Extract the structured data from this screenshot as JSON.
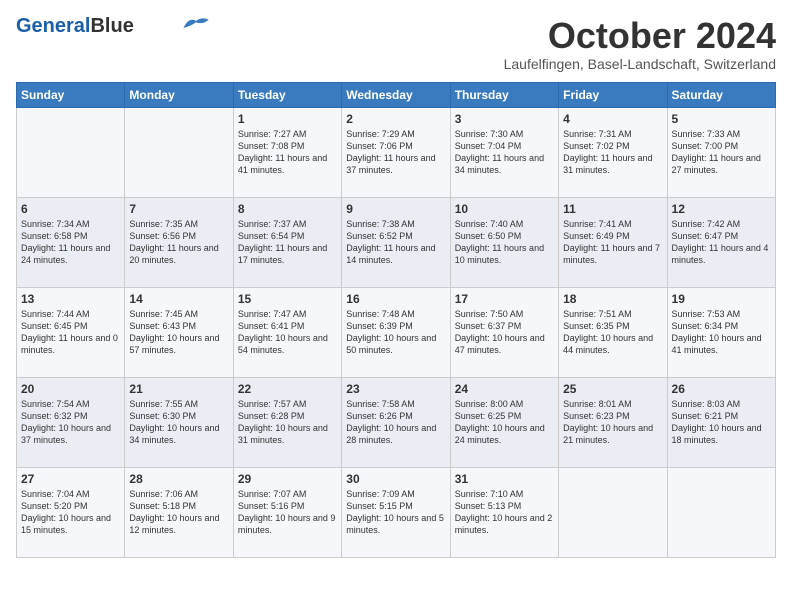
{
  "header": {
    "logo_line1": "General",
    "logo_line2": "Blue",
    "month_year": "October 2024",
    "location": "Laufelfingen, Basel-Landschaft, Switzerland"
  },
  "days_of_week": [
    "Sunday",
    "Monday",
    "Tuesday",
    "Wednesday",
    "Thursday",
    "Friday",
    "Saturday"
  ],
  "weeks": [
    [
      {
        "day": "",
        "info": ""
      },
      {
        "day": "",
        "info": ""
      },
      {
        "day": "1",
        "info": "Sunrise: 7:27 AM\nSunset: 7:08 PM\nDaylight: 11 hours and 41 minutes."
      },
      {
        "day": "2",
        "info": "Sunrise: 7:29 AM\nSunset: 7:06 PM\nDaylight: 11 hours and 37 minutes."
      },
      {
        "day": "3",
        "info": "Sunrise: 7:30 AM\nSunset: 7:04 PM\nDaylight: 11 hours and 34 minutes."
      },
      {
        "day": "4",
        "info": "Sunrise: 7:31 AM\nSunset: 7:02 PM\nDaylight: 11 hours and 31 minutes."
      },
      {
        "day": "5",
        "info": "Sunrise: 7:33 AM\nSunset: 7:00 PM\nDaylight: 11 hours and 27 minutes."
      }
    ],
    [
      {
        "day": "6",
        "info": "Sunrise: 7:34 AM\nSunset: 6:58 PM\nDaylight: 11 hours and 24 minutes."
      },
      {
        "day": "7",
        "info": "Sunrise: 7:35 AM\nSunset: 6:56 PM\nDaylight: 11 hours and 20 minutes."
      },
      {
        "day": "8",
        "info": "Sunrise: 7:37 AM\nSunset: 6:54 PM\nDaylight: 11 hours and 17 minutes."
      },
      {
        "day": "9",
        "info": "Sunrise: 7:38 AM\nSunset: 6:52 PM\nDaylight: 11 hours and 14 minutes."
      },
      {
        "day": "10",
        "info": "Sunrise: 7:40 AM\nSunset: 6:50 PM\nDaylight: 11 hours and 10 minutes."
      },
      {
        "day": "11",
        "info": "Sunrise: 7:41 AM\nSunset: 6:49 PM\nDaylight: 11 hours and 7 minutes."
      },
      {
        "day": "12",
        "info": "Sunrise: 7:42 AM\nSunset: 6:47 PM\nDaylight: 11 hours and 4 minutes."
      }
    ],
    [
      {
        "day": "13",
        "info": "Sunrise: 7:44 AM\nSunset: 6:45 PM\nDaylight: 11 hours and 0 minutes."
      },
      {
        "day": "14",
        "info": "Sunrise: 7:45 AM\nSunset: 6:43 PM\nDaylight: 10 hours and 57 minutes."
      },
      {
        "day": "15",
        "info": "Sunrise: 7:47 AM\nSunset: 6:41 PM\nDaylight: 10 hours and 54 minutes."
      },
      {
        "day": "16",
        "info": "Sunrise: 7:48 AM\nSunset: 6:39 PM\nDaylight: 10 hours and 50 minutes."
      },
      {
        "day": "17",
        "info": "Sunrise: 7:50 AM\nSunset: 6:37 PM\nDaylight: 10 hours and 47 minutes."
      },
      {
        "day": "18",
        "info": "Sunrise: 7:51 AM\nSunset: 6:35 PM\nDaylight: 10 hours and 44 minutes."
      },
      {
        "day": "19",
        "info": "Sunrise: 7:53 AM\nSunset: 6:34 PM\nDaylight: 10 hours and 41 minutes."
      }
    ],
    [
      {
        "day": "20",
        "info": "Sunrise: 7:54 AM\nSunset: 6:32 PM\nDaylight: 10 hours and 37 minutes."
      },
      {
        "day": "21",
        "info": "Sunrise: 7:55 AM\nSunset: 6:30 PM\nDaylight: 10 hours and 34 minutes."
      },
      {
        "day": "22",
        "info": "Sunrise: 7:57 AM\nSunset: 6:28 PM\nDaylight: 10 hours and 31 minutes."
      },
      {
        "day": "23",
        "info": "Sunrise: 7:58 AM\nSunset: 6:26 PM\nDaylight: 10 hours and 28 minutes."
      },
      {
        "day": "24",
        "info": "Sunrise: 8:00 AM\nSunset: 6:25 PM\nDaylight: 10 hours and 24 minutes."
      },
      {
        "day": "25",
        "info": "Sunrise: 8:01 AM\nSunset: 6:23 PM\nDaylight: 10 hours and 21 minutes."
      },
      {
        "day": "26",
        "info": "Sunrise: 8:03 AM\nSunset: 6:21 PM\nDaylight: 10 hours and 18 minutes."
      }
    ],
    [
      {
        "day": "27",
        "info": "Sunrise: 7:04 AM\nSunset: 5:20 PM\nDaylight: 10 hours and 15 minutes."
      },
      {
        "day": "28",
        "info": "Sunrise: 7:06 AM\nSunset: 5:18 PM\nDaylight: 10 hours and 12 minutes."
      },
      {
        "day": "29",
        "info": "Sunrise: 7:07 AM\nSunset: 5:16 PM\nDaylight: 10 hours and 9 minutes."
      },
      {
        "day": "30",
        "info": "Sunrise: 7:09 AM\nSunset: 5:15 PM\nDaylight: 10 hours and 5 minutes."
      },
      {
        "day": "31",
        "info": "Sunrise: 7:10 AM\nSunset: 5:13 PM\nDaylight: 10 hours and 2 minutes."
      },
      {
        "day": "",
        "info": ""
      },
      {
        "day": "",
        "info": ""
      }
    ]
  ]
}
